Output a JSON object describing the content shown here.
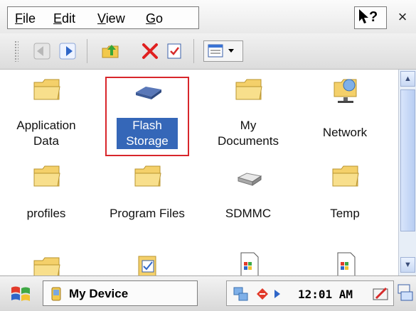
{
  "menu": {
    "items": [
      {
        "label": "File",
        "accel": "F"
      },
      {
        "label": "Edit",
        "accel": "E"
      },
      {
        "label": "View",
        "accel": "V"
      },
      {
        "label": "Go",
        "accel": "G"
      }
    ],
    "help_label": "?",
    "close_label": "×"
  },
  "toolbar": {
    "buttons": [
      "back-icon",
      "forward-icon",
      "up-folder-icon",
      "delete-icon",
      "properties-icon",
      "view-menu-icon"
    ]
  },
  "files": [
    {
      "label_line1": "Application",
      "label_line2": "Data",
      "icon": "folder-icon"
    },
    {
      "label_line1": "Flash",
      "label_line2": "Storage",
      "icon": "flash-storage-icon",
      "selected": true
    },
    {
      "label_line1": "My",
      "label_line2": "Documents",
      "icon": "folder-icon"
    },
    {
      "label_line1": "Network",
      "label_line2": "",
      "icon": "network-folder-icon"
    },
    {
      "label_line1": "profiles",
      "label_line2": "",
      "icon": "folder-icon"
    },
    {
      "label_line1": "Program Files",
      "label_line2": "",
      "icon": "folder-icon"
    },
    {
      "label_line1": "SDMMC",
      "label_line2": "",
      "icon": "sd-card-drive-icon"
    },
    {
      "label_line1": "Temp",
      "label_line2": "",
      "icon": "folder-icon"
    },
    {
      "label_line1": "",
      "label_line2": "",
      "icon": "folder-icon"
    },
    {
      "label_line1": "",
      "label_line2": "",
      "icon": "control-panel-icon"
    },
    {
      "label_line1": "",
      "label_line2": "",
      "icon": "document-icon"
    },
    {
      "label_line1": "",
      "label_line2": "",
      "icon": "document-icon"
    }
  ],
  "taskbar": {
    "task_label": "My Device",
    "time": "12:01 AM"
  },
  "colors": {
    "selection": "#3567b8",
    "highlight_box": "#d8262b",
    "folder": "#f4d06a"
  }
}
